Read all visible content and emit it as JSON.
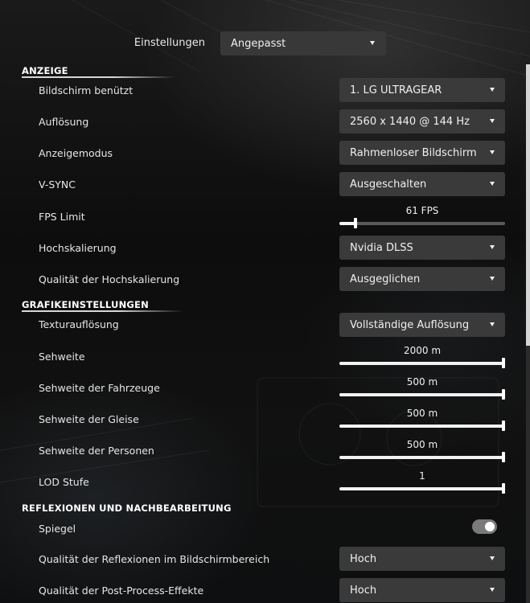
{
  "header": {
    "preset_label": "Einstellungen",
    "preset_value": "Angepasst"
  },
  "sections": {
    "display": "ANZEIGE",
    "graphics": "GRAFIKEINSTELLUNGEN",
    "reflections": "REFLEXIONEN UND NACHBEARBEITUNG"
  },
  "display": {
    "monitor_label": "Bildschirm benützt",
    "monitor_value": "1. LG ULTRAGEAR",
    "resolution_label": "Auflösung",
    "resolution_value": "2560 x 1440 @ 144 Hz",
    "mode_label": "Anzeigemodus",
    "mode_value": "Rahmenloser Bildschirm",
    "vsync_label": "V-SYNC",
    "vsync_value": "Ausgeschalten",
    "fps_label": "FPS Limit",
    "fps_value": "61 FPS",
    "fps_fraction": 0.095,
    "upscale_label": "Hochskalierung",
    "upscale_value": "Nvidia DLSS",
    "upscale_quality_label": "Qualität der Hochskalierung",
    "upscale_quality_value": "Ausgeglichen"
  },
  "graphics": {
    "texture_label": "Texturauflösung",
    "texture_value": "Vollständige Auflösung",
    "view_distance_label": "Sehweite",
    "view_distance_value": "2000 m",
    "view_distance_fraction": 1.0,
    "vehicles_label": "Sehweite der Fahrzeuge",
    "vehicles_value": "500 m",
    "vehicles_fraction": 1.0,
    "tracks_label": "Sehweite der Gleise",
    "tracks_value": "500 m",
    "tracks_fraction": 1.0,
    "people_label": "Sehweite der Personen",
    "people_value": "500 m",
    "people_fraction": 1.0,
    "lod_label": "LOD Stufe",
    "lod_value": "1",
    "lod_fraction": 1.0
  },
  "reflections": {
    "mirror_label": "Spiegel",
    "mirror_on": true,
    "ssr_label": "Qualität der Reflexionen im Bildschirmbereich",
    "ssr_value": "Hoch",
    "post_label": "Qualität der Post-Process-Effekte",
    "post_value": "Hoch"
  },
  "icons": {
    "dropdown_arrow": "chevron-down-icon"
  }
}
